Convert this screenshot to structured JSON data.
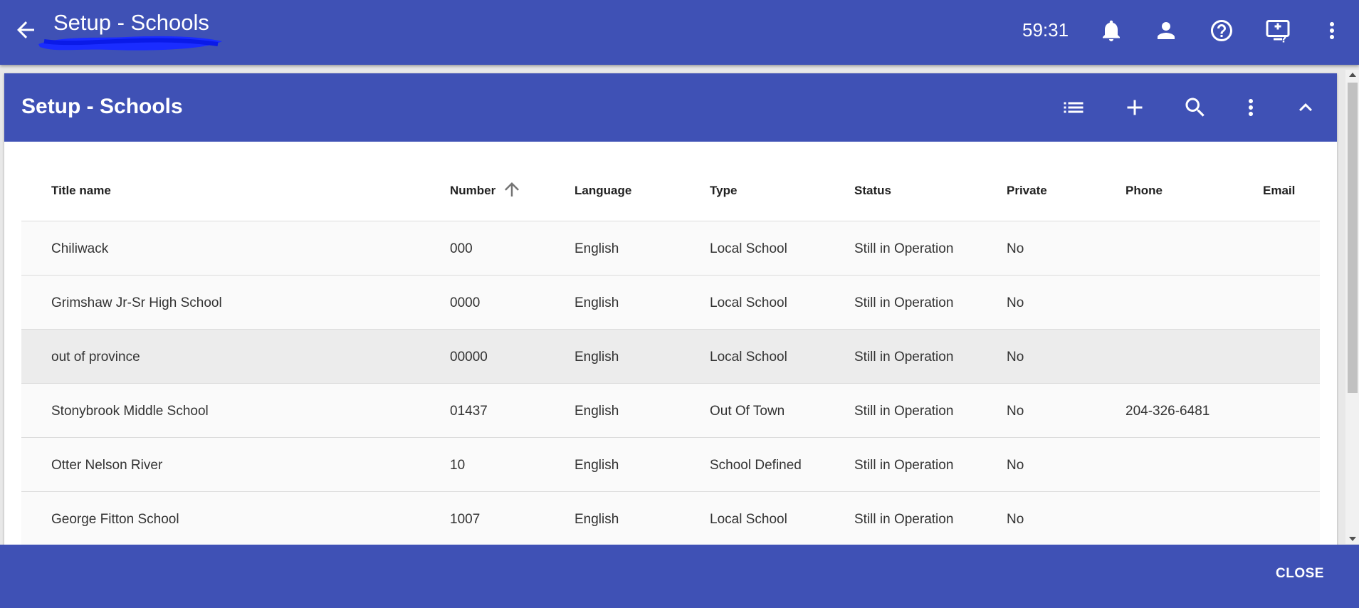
{
  "appbar": {
    "title": "Setup - Schools",
    "timer": "59:31",
    "icons": [
      "back-arrow-icon",
      "bell-icon",
      "person-icon",
      "help-circle-icon",
      "monitor-help-icon",
      "more-vert-icon"
    ],
    "color": "#3f51b5"
  },
  "panel": {
    "title": "Setup - Schools",
    "icons": [
      "list-icon",
      "add-icon",
      "search-icon",
      "more-vert-icon",
      "chevron-up-icon"
    ]
  },
  "table": {
    "columns": [
      "Title   name",
      "Number",
      "Language",
      "Type",
      "Status",
      "Private",
      "Phone",
      "Email"
    ],
    "sorted_column": "Number",
    "sort_direction": "ascending",
    "rows": [
      {
        "name": "Chiliwack",
        "number": "000",
        "language": "English",
        "type": "Local School",
        "status": "Still in Operation",
        "private": "No",
        "phone": "",
        "email": ""
      },
      {
        "name": "Grimshaw Jr-Sr High School",
        "number": "0000",
        "language": "English",
        "type": "Local School",
        "status": "Still in Operation",
        "private": "No",
        "phone": "",
        "email": ""
      },
      {
        "name": "out of province",
        "number": "00000",
        "language": "English",
        "type": "Local School",
        "status": "Still in Operation",
        "private": "No",
        "phone": "",
        "email": ""
      },
      {
        "name": "Stonybrook Middle School",
        "number": "01437",
        "language": "English",
        "type": "Out Of Town",
        "status": "Still in Operation",
        "private": "No",
        "phone": "204-326-6481",
        "email": ""
      },
      {
        "name": "Otter Nelson River",
        "number": "10",
        "language": "English",
        "type": "School Defined",
        "status": "Still in Operation",
        "private": "No",
        "phone": "",
        "email": ""
      },
      {
        "name": "George Fitton School",
        "number": "1007",
        "language": "English",
        "type": "Local School",
        "status": "Still in Operation",
        "private": "No",
        "phone": "",
        "email": ""
      }
    ],
    "highlighted_row": 2
  },
  "footer": {
    "close_label": "CLOSE"
  }
}
